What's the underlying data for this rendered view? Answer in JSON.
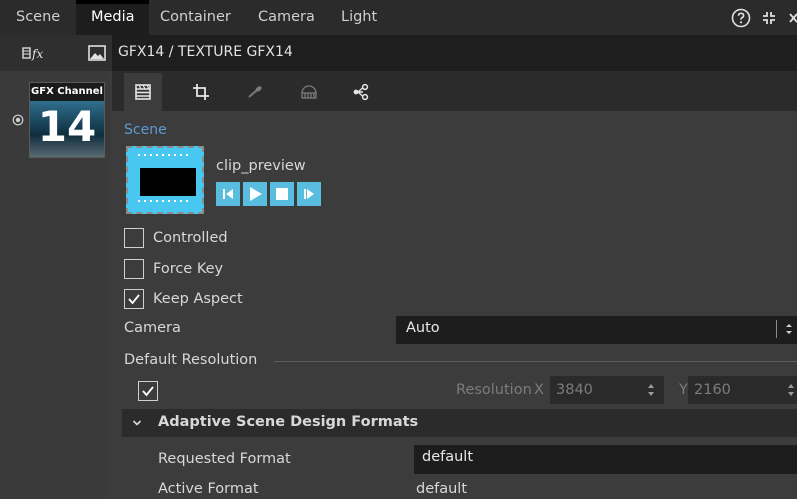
{
  "menu": {
    "items": [
      "Scene",
      "Media",
      "Container",
      "Camera",
      "Light"
    ],
    "active": "Media"
  },
  "path": {
    "label": "GFX14 / TEXTURE  GFX14"
  },
  "channel": {
    "title": "GFX Channel",
    "number": "14"
  },
  "scene": {
    "section_label": "Scene",
    "clip_name": "clip_preview"
  },
  "options": {
    "controlled": {
      "label": "Controlled",
      "checked": false
    },
    "force_key": {
      "label": "Force Key",
      "checked": false
    },
    "keep_aspect": {
      "label": "Keep Aspect",
      "checked": true
    }
  },
  "camera": {
    "label": "Camera",
    "value": "Auto"
  },
  "default_resolution": {
    "label": "Default Resolution",
    "checked": true,
    "resolution_label": "Resolution",
    "x_label": "X",
    "x_value": "3840",
    "y_label": "Y",
    "y_value": "2160"
  },
  "adaptive": {
    "header": "Adaptive Scene Design Formats",
    "requested_label": "Requested Format",
    "requested_value": "default",
    "active_label": "Active Format",
    "active_value": "default"
  },
  "icons": {
    "help": "help-circle-icon",
    "fullscreen": "fullscreen-icon",
    "close": "close-icon",
    "fx": "fx-icon",
    "image": "image-icon",
    "radio": "radio-icon",
    "clip_tab": "clip-settings-icon",
    "crop_tab": "crop-icon",
    "key_tab": "key-icon",
    "mask_tab": "mask-icon",
    "share_tab": "share-icon"
  },
  "colors": {
    "accent": "#5b9bd5",
    "preview_cyan": "#48c7f0",
    "transport": "#59bde0"
  }
}
